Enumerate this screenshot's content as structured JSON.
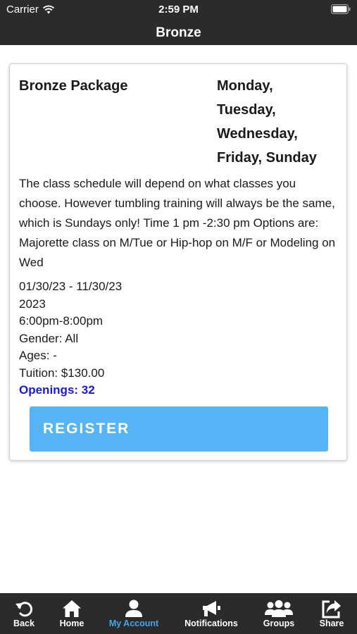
{
  "status_bar": {
    "carrier": "Carrier",
    "time": "2:59 PM"
  },
  "nav": {
    "title": "Bronze"
  },
  "card": {
    "package_name": "Bronze Package",
    "days": [
      "Monday,",
      "Tuesday,",
      "Wednesday,",
      "Friday, Sunday"
    ],
    "description": "The class schedule will depend on what classes you choose. However tumbling training will always be the same, which is Sundays only! Time 1 pm -2:30 pm Options are: Majorette class on M/Tue or Hip-hop on M/F or Modeling on Wed",
    "date_range": "01/30/23 - 11/30/23",
    "year": "2023",
    "time_range": "6:00pm-8:00pm",
    "gender": "Gender: All",
    "ages": "Ages: -",
    "tuition": "Tuition: $130.00",
    "openings": "Openings: 32",
    "register_label": "REGISTER"
  },
  "tabs": [
    {
      "label": "Back",
      "icon": "back-icon",
      "active": false
    },
    {
      "label": "Home",
      "icon": "home-icon",
      "active": false
    },
    {
      "label": "My Account",
      "icon": "user-icon",
      "active": true
    },
    {
      "label": "Notifications",
      "icon": "megaphone-icon",
      "active": false
    },
    {
      "label": "Groups",
      "icon": "groups-icon",
      "active": false
    },
    {
      "label": "Share",
      "icon": "share-icon",
      "active": false
    }
  ],
  "colors": {
    "bar_background": "#2b2b2b",
    "register_button": "#54b4f5",
    "openings_text": "#1a1ad0",
    "active_tab": "#4aa3e6"
  }
}
